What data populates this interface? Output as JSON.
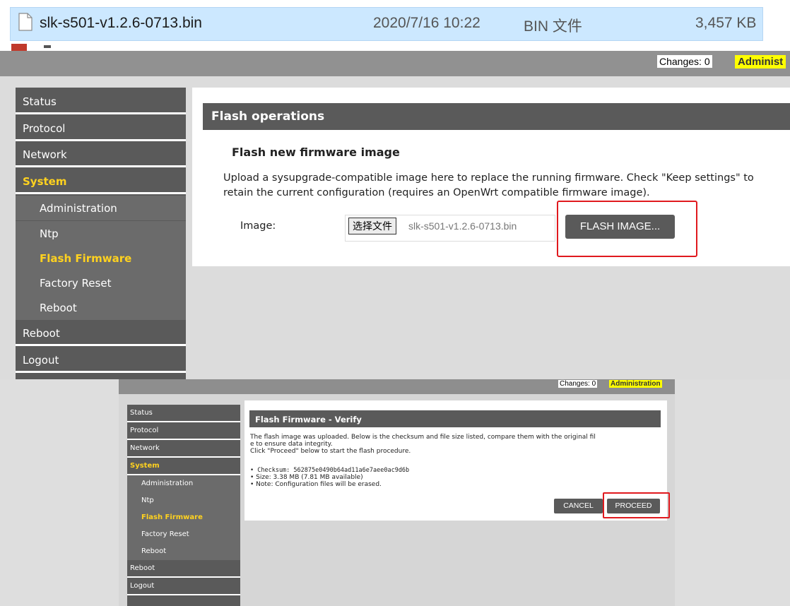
{
  "explorer": {
    "file_name": "slk-s501-v1.2.6-0713.bin",
    "modified": "2020/7/16 10:22",
    "type": "BIN 文件",
    "size": "3,457 KB"
  },
  "panel1": {
    "topbar": {
      "changes": "Changes: 0",
      "admin": "Administ"
    },
    "sidebar": [
      {
        "label": "Status",
        "level": 1,
        "active": false
      },
      {
        "label": "Protocol",
        "level": 1,
        "active": false
      },
      {
        "label": "Network",
        "level": 1,
        "active": false
      },
      {
        "label": "System",
        "level": 1,
        "active": true
      },
      {
        "label": "Administration",
        "level": 2,
        "active": false
      },
      {
        "label": "Ntp",
        "level": 2,
        "active": false
      },
      {
        "label": "Flash Firmware",
        "level": 2,
        "active": true
      },
      {
        "label": "Factory Reset",
        "level": 2,
        "active": false
      },
      {
        "label": "Reboot",
        "level": 2,
        "active": false
      },
      {
        "label": "Reboot",
        "level": 1,
        "active": false
      },
      {
        "label": "Logout",
        "level": 1,
        "active": false
      }
    ],
    "heading": "Flash operations",
    "subheading": "Flash new firmware image",
    "description_line1": "Upload a sysupgrade-compatible image here to replace the running firmware. Check \"Keep settings\" to",
    "description_line2": "retain the current configuration (requires an OpenWrt compatible firmware image).",
    "image_label": "Image:",
    "choose_file": "选择文件",
    "chosen_file": "slk-s501-v1.2.6-0713.bin",
    "flash_button": "FLASH IMAGE..."
  },
  "panel2": {
    "topbar": {
      "changes": "Changes: 0",
      "admin": "Administration"
    },
    "sidebar": [
      {
        "label": "Status",
        "level": 1,
        "active": false
      },
      {
        "label": "Protocol",
        "level": 1,
        "active": false
      },
      {
        "label": "Network",
        "level": 1,
        "active": false
      },
      {
        "label": "System",
        "level": 1,
        "active": true
      },
      {
        "label": "Administration",
        "level": 2,
        "active": false
      },
      {
        "label": "Ntp",
        "level": 2,
        "active": false
      },
      {
        "label": "Flash Firmware",
        "level": 2,
        "active": true
      },
      {
        "label": "Factory Reset",
        "level": 2,
        "active": false
      },
      {
        "label": "Reboot",
        "level": 2,
        "active": false
      },
      {
        "label": "Reboot",
        "level": 1,
        "active": false
      },
      {
        "label": "Logout",
        "level": 1,
        "active": false
      }
    ],
    "heading": "Flash Firmware - Verify",
    "text_line1": "The flash image was uploaded. Below is the checksum and file size listed, compare them with the original fil",
    "text_line2": "e to ensure data integrity.",
    "text_line3": "Click \"Proceed\" below to start the flash procedure.",
    "checksum": "• Checksum: 562875e0490b64ad11a6e7aee0ac9d6b",
    "size": "• Size: 3.38 MB (7.81 MB available)",
    "note": "• Note: Configuration files will be erased.",
    "cancel_button": "CANCEL",
    "proceed_button": "PROCEED"
  },
  "colors": {
    "sidebar_bg": "#5a5a5a",
    "active_item": "#ffd21f",
    "highlight_box": "#e0191e",
    "explorer_selection": "#cce8ff"
  }
}
